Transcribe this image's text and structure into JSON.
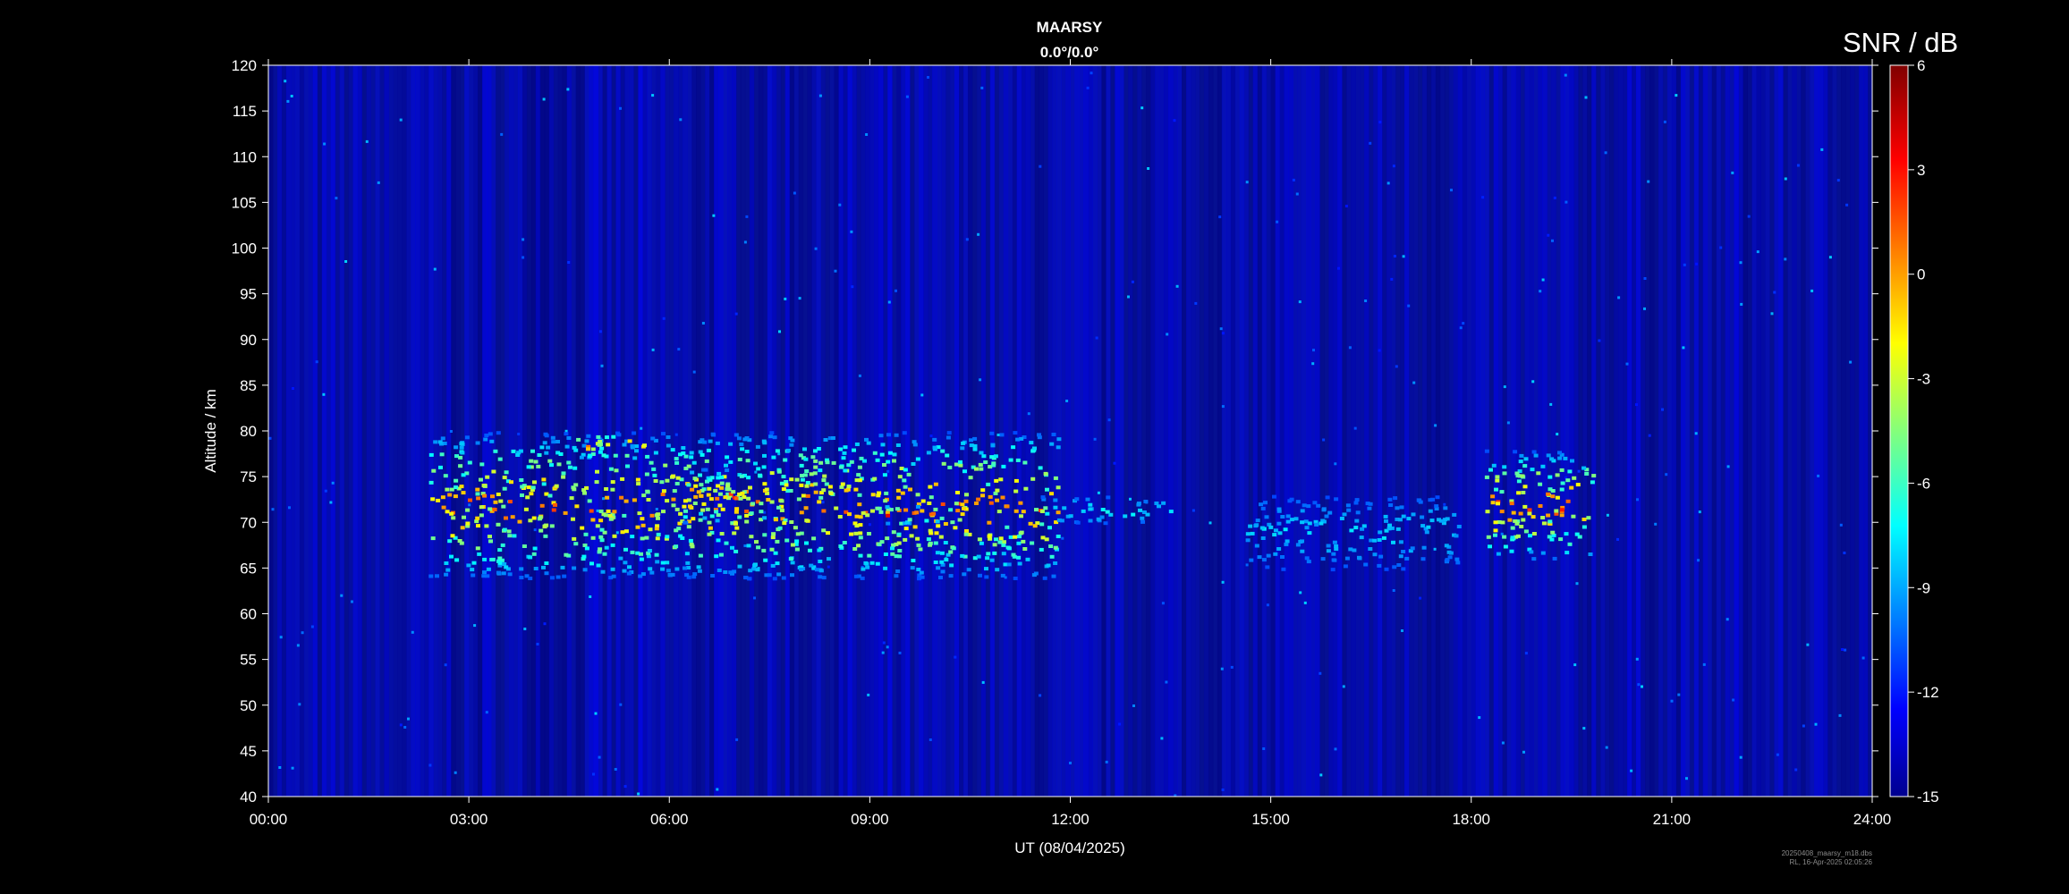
{
  "chart_data": {
    "type": "heatmap",
    "title": "MAARSY",
    "subtitle": "0.0°/0.0°",
    "xlabel": "UT (08/04/2025)",
    "ylabel": "Altitude / km",
    "x_ticks": [
      "00:00",
      "03:00",
      "06:00",
      "09:00",
      "12:00",
      "15:00",
      "18:00",
      "21:00",
      "24:00"
    ],
    "x_range_hours": [
      0,
      24
    ],
    "y_ticks": [
      40,
      45,
      50,
      55,
      60,
      65,
      70,
      75,
      80,
      85,
      90,
      95,
      100,
      105,
      110,
      115,
      120
    ],
    "ylim": [
      40,
      120
    ],
    "colorbar": {
      "label": "SNR / dB",
      "ticks": [
        6,
        3,
        0,
        -3,
        -6,
        -9,
        -12,
        -15
      ],
      "range": [
        -15,
        6
      ],
      "colormap": "jet"
    },
    "background_snr_db": -14,
    "echo_regions": [
      {
        "t_start": 2.4,
        "t_end": 11.8,
        "alt_low": 64,
        "alt_high": 80,
        "peak_snr_db": 3
      },
      {
        "t_start": 4.6,
        "t_end": 5.6,
        "alt_low": 77,
        "alt_high": 80,
        "peak_snr_db": 4
      },
      {
        "t_start": 6.2,
        "t_end": 7.4,
        "alt_low": 70,
        "alt_high": 76,
        "peak_snr_db": 5
      },
      {
        "t_start": 8.8,
        "t_end": 10.2,
        "alt_low": 70,
        "alt_high": 72,
        "peak_snr_db": 5
      },
      {
        "t_start": 11.5,
        "t_end": 13.5,
        "alt_low": 70,
        "alt_high": 73,
        "peak_snr_db": -6
      },
      {
        "t_start": 14.6,
        "t_end": 17.8,
        "alt_low": 65,
        "alt_high": 73,
        "peak_snr_db": -7
      },
      {
        "t_start": 18.2,
        "t_end": 19.8,
        "alt_low": 66,
        "alt_high": 78,
        "peak_snr_db": 4
      }
    ]
  },
  "footer": {
    "line1": "20250408_maarsy_m18.dbs",
    "line2": "RL, 16-Apr-2025 02:05:26"
  }
}
